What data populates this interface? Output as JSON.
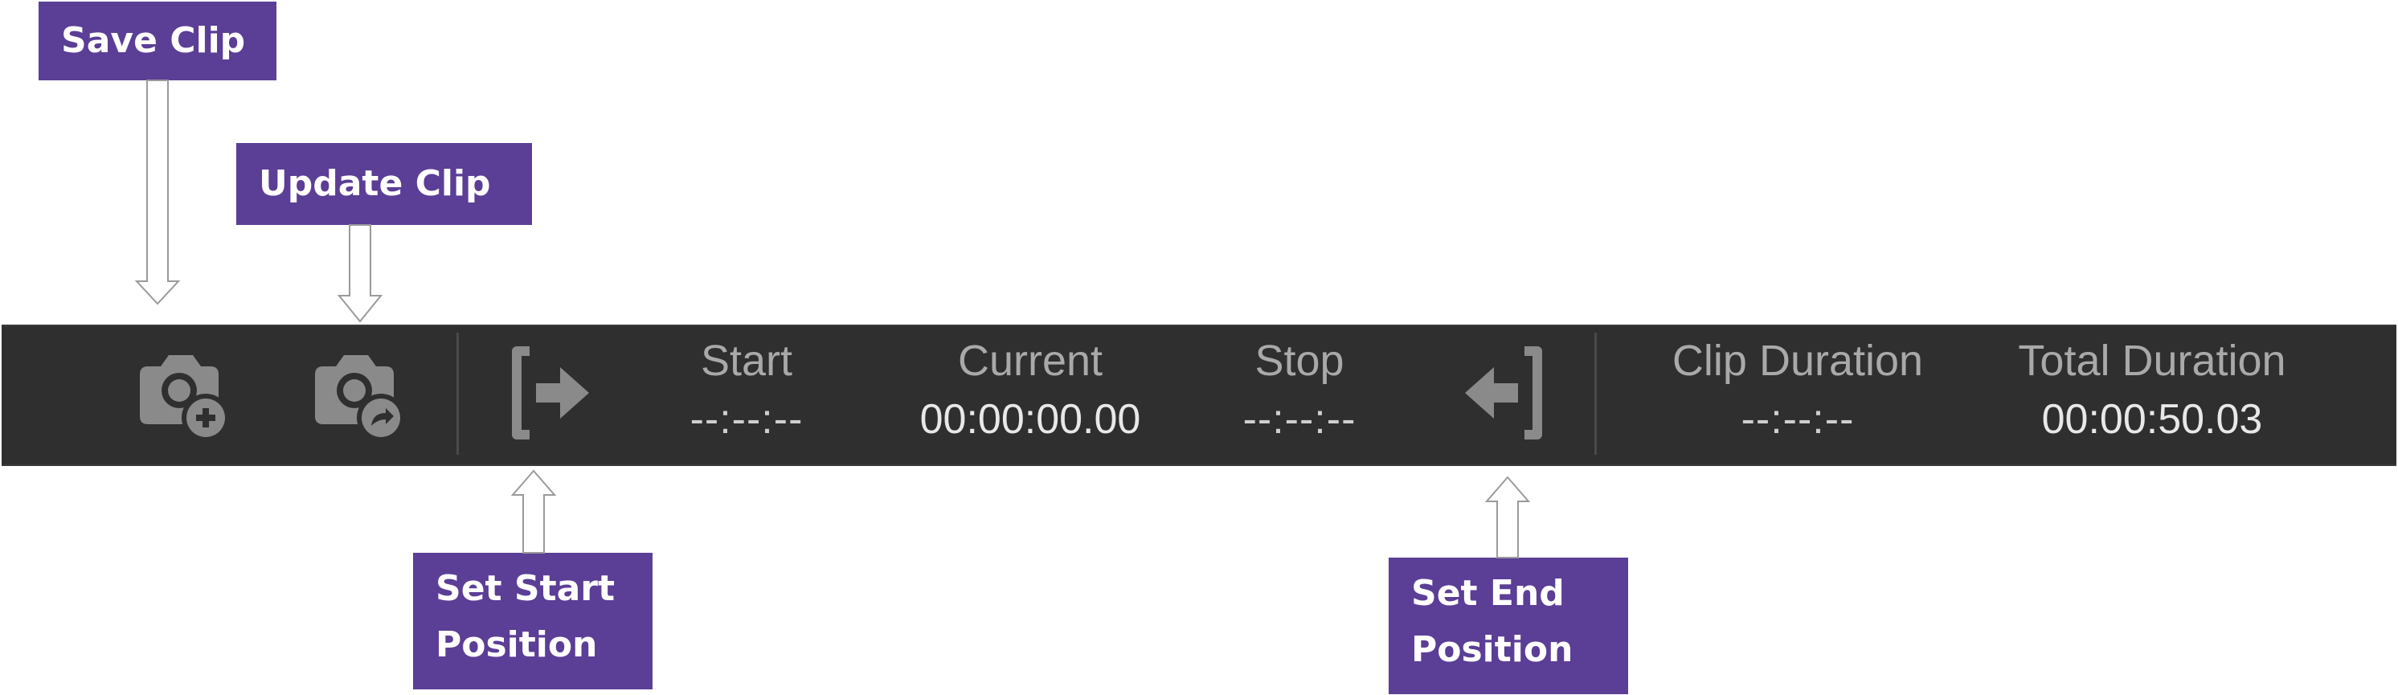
{
  "callouts": {
    "save_clip": "Save Clip",
    "update_clip": "Update Clip",
    "set_start": "Set Start\nPosition",
    "set_end": "Set End\nPosition"
  },
  "toolbar": {
    "save_clip_icon": "camera-plus-icon",
    "update_clip_icon": "camera-share-icon",
    "set_start_icon": "bracket-arrow-right-icon",
    "set_end_icon": "arrow-left-bracket-icon",
    "start": {
      "label": "Start",
      "value": "--:--:--"
    },
    "current": {
      "label": "Current",
      "value": "00:00:00.00"
    },
    "stop": {
      "label": "Stop",
      "value": "--:--:--"
    },
    "clip_duration": {
      "label": "Clip Duration",
      "value": "--:--:--"
    },
    "total_duration": {
      "label": "Total Duration",
      "value": "00:00:50.03"
    }
  },
  "colors": {
    "toolbar_bg": "#2f2f2f",
    "callout_bg": "#5b3e96",
    "icon_gray": "#8a8a8a"
  }
}
